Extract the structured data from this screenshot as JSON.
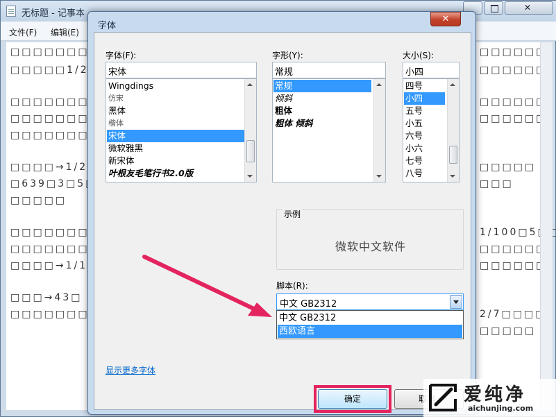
{
  "notepad": {
    "title": "无标题 - 记事本",
    "menus": [
      "文件(F)",
      "编辑(E)"
    ],
    "text_lines": [
      "□□□□□□□□□□",
      "□□□□□1/200□",
      "□□□□□□□□□□",
      "□□□□□□□□□□",
      "□□□□□□□□□",
      "□□□□→1/2□",
      "□639□3□5□",
      "□□□□□",
      "□□□□□□□□□□",
      "□□□□□□□□□□",
      "□□□□→1/18□",
      "□□□→43□",
      "□□□□□□□□□□"
    ],
    "right_text_lines": [
      "□□□□□□",
      "□□□□□□",
      "□□□□□□",
      "□□□□□□",
      "□□□□□",
      "□□□",
      "1/100□5□□",
      "□□□□□□",
      "□□□□□□",
      "2/7□□□□",
      "□□□□□"
    ]
  },
  "dialog": {
    "title": "字体",
    "close_symbol": "✕",
    "font": {
      "label": "字体(F):",
      "value": "宋体",
      "items": [
        "Wingdings",
        "仿宋",
        "黑体",
        "楷体",
        "宋体",
        "微软雅黑",
        "新宋体",
        "叶根友毛笔行书2.0版"
      ],
      "selected_index": 4
    },
    "style": {
      "label": "字形(Y):",
      "value": "常规",
      "items": [
        "常规",
        "倾斜",
        "粗体",
        "粗体 倾斜"
      ],
      "selected_index": 0
    },
    "size": {
      "label": "大小(S):",
      "value": "小四",
      "items": [
        "四号",
        "小四",
        "五号",
        "小五",
        "六号",
        "小六",
        "七号",
        "八号"
      ],
      "selected_index": 1
    },
    "sample": {
      "label": "示例",
      "text": "微软中文软件"
    },
    "script": {
      "label": "脚本(R):",
      "value": "中文 GB2312",
      "options": [
        "中文 GB2312",
        "西欧语言"
      ],
      "highlighted_index": 1
    },
    "more_fonts": "显示更多字体",
    "ok_label": "确定",
    "cancel_label": "取消"
  },
  "watermark": {
    "brand": "爱纯净",
    "url": "aichunjing.com"
  },
  "colors": {
    "selection": "#3399ff",
    "annotation": "#e3245e",
    "link": "#0066cc"
  }
}
